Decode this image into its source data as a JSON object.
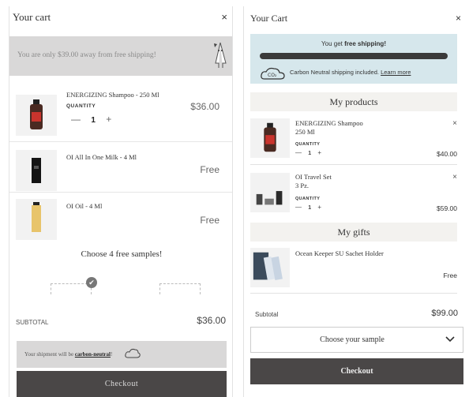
{
  "left": {
    "title": "Your cart",
    "close": "×",
    "shipping_msg": "You are only $39.00 away from free shipping!",
    "items": [
      {
        "name": "ENERGIZING Shampoo - 250 Ml",
        "qty_label": "QUANTITY",
        "qty": "1",
        "minus": "—",
        "plus": "+",
        "price": "$36.00"
      },
      {
        "name": "OI All In One Milk - 4 Ml",
        "price": "Free"
      },
      {
        "name": "OI Oil - 4 Ml",
        "price": "Free"
      }
    ],
    "samples_title": "Choose 4 free samples!",
    "subtotal_label": "SUBTOTAL",
    "subtotal_value": "$36.00",
    "carbon_prefix": "Your shipment will be ",
    "carbon_link": "carbon-neutral",
    "carbon_suffix": "!",
    "checkout": "Checkout"
  },
  "right": {
    "title": "Your Cart",
    "close": "×",
    "shipping_prefix": "You get ",
    "shipping_bold": "free shipping!",
    "progress": 1.0,
    "carbon_text": "Carbon Neutral shipping included. ",
    "carbon_link": "Learn more",
    "cloud_label": "CO₂",
    "products_title": "My products",
    "products": [
      {
        "name": "ENERGIZING Shampoo",
        "size": "250 Ml",
        "qty_label": "QUANTITY",
        "qty": "1",
        "minus": "—",
        "plus": "+",
        "price": "$40.00",
        "remove": "×"
      },
      {
        "name": "OI Travel Set",
        "size": "3 Pz.",
        "qty_label": "QUANTITY",
        "qty": "1",
        "minus": "—",
        "plus": "+",
        "price": "$59.00",
        "remove": "×"
      }
    ],
    "gifts_title": "My gifts",
    "gifts": [
      {
        "name": "Ocean Keeper SU Sachet Holder",
        "price": "Free"
      }
    ],
    "subtotal_label": "Subtotal",
    "subtotal_value": "$99.00",
    "sample_select": "Choose your sample",
    "checkout": "Checkout"
  },
  "colors": {
    "checkout_bg": "#4a4747",
    "left_banner_bg": "#d9d8d8",
    "right_banner_bg": "#d6e7ec",
    "section_bg": "#f3f2ef"
  }
}
